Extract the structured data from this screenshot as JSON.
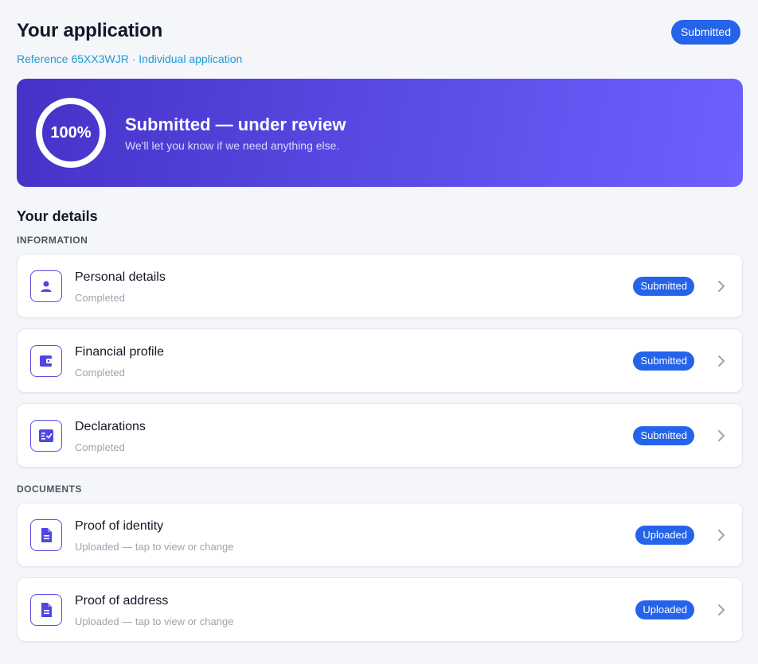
{
  "header": {
    "title": "Your application",
    "subtitle": "Reference 65XX3WJR · Individual application",
    "status": "Submitted"
  },
  "hero": {
    "progress_label": "100%",
    "progress_fraction": 1.0,
    "title": "Submitted — under review",
    "subtitle": "We'll let you know if we need anything else."
  },
  "details": {
    "title": "Your details",
    "information_label": "INFORMATION",
    "documents_label": "DOCUMENTS",
    "items": [
      {
        "icon": "person-icon",
        "title": "Personal details",
        "subtitle": "Completed",
        "badge": "Submitted"
      },
      {
        "icon": "wallet-icon",
        "title": "Financial profile",
        "subtitle": "Completed",
        "badge": "Submitted"
      },
      {
        "icon": "checklist-icon",
        "title": "Declarations",
        "subtitle": "Completed",
        "badge": "Submitted"
      }
    ],
    "documents": [
      {
        "icon": "document-icon",
        "title": "Proof of identity",
        "subtitle": "Uploaded — tap to view or change",
        "badge": "Uploaded"
      },
      {
        "icon": "document-icon",
        "title": "Proof of address",
        "subtitle": "Uploaded — tap to view or change",
        "badge": "Uploaded"
      }
    ]
  },
  "colors": {
    "accent": "#2563eb",
    "brand": "#5b4fe0",
    "link": "#1e9bd0"
  }
}
